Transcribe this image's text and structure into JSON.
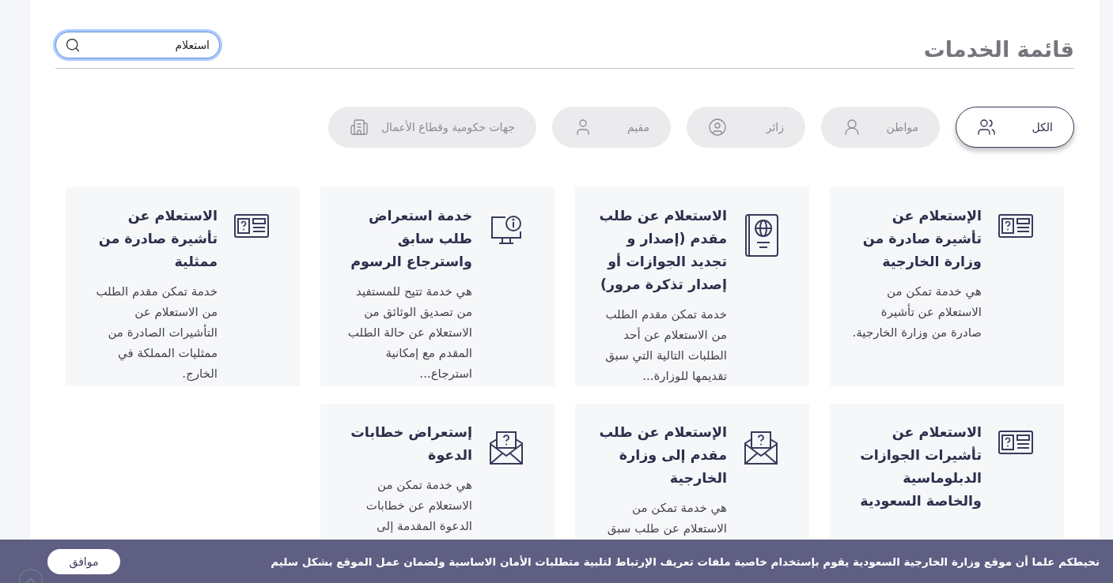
{
  "page_title": "قائمة الخدمات",
  "search": {
    "value": "استعلام",
    "focused": true
  },
  "filters": [
    {
      "label": "الكل",
      "kind": "group",
      "selected": true
    },
    {
      "label": "مواطن",
      "kind": "citizen",
      "selected": false
    },
    {
      "label": "زائر",
      "kind": "visitor",
      "selected": false
    },
    {
      "label": "مقيم",
      "kind": "resident",
      "selected": false
    },
    {
      "label": "جهات حكومية وقطاع الأعمال",
      "kind": "business",
      "selected": false
    }
  ],
  "services": [
    {
      "kind": "visa",
      "title": "الإستعلام عن تأشيرة صادرة من وزارة الخارجية",
      "description": "هي خدمة تمكن من الاستعلام عن تأشيرة صادرة من وزارة الخارجية."
    },
    {
      "kind": "passport",
      "title": "الاستعلام عن طلب مقدم (إصدار و تجديد الجوازات أو إصدار تذكرة مرور)",
      "description": "خدمة تمكن مقدم الطلب من الاستعلام عن أحد الطلبات التالية التي سبق تقديمها للوزارة..."
    },
    {
      "kind": "monitor",
      "title": "خدمة استعراض طلب سابق واسترجاع الرسوم",
      "description": "هي خدمة تتيح للمستفيد من تصديق الوثائق من الاستعلام عن حالة الطلب المقدم مع إمكانية استرجاع..."
    },
    {
      "kind": "visa",
      "title": "الاستعلام عن تأشيرة صادرة من ممثلية",
      "description": "خدمة تمكن مقدم الطلب من الاستعلام عن التأشيرات الصادرة من ممثليات المملكة في الخارج."
    },
    {
      "kind": "visa",
      "title": "الاستعلام عن تأشيرات الجوازات الدبلوماسية والخاصة السعودية"
    },
    {
      "kind": "envelope",
      "title": "الإستعلام عن طلب مقدم إلى وزارة الخارجية",
      "description": "هي خدمة تمكن من الاستعلام عن طلب سبق"
    },
    {
      "kind": "envelope",
      "title": "إستعراض خطابات الدعوة",
      "description": "هي خدمة تمكن من الاستعلام عن خطابات الدعوة المقدمة إلى"
    }
  ],
  "cookie_banner": {
    "message": "نحيطكم علما أن موقع وزارة الخارجية السعودية يقوم بإستخدام خاصية ملفات تعريف الإرتباط لتلبية متطلبات الأمان الاساسية ولضمان عمل الموقع بشكل سليم",
    "button": "موافق"
  }
}
